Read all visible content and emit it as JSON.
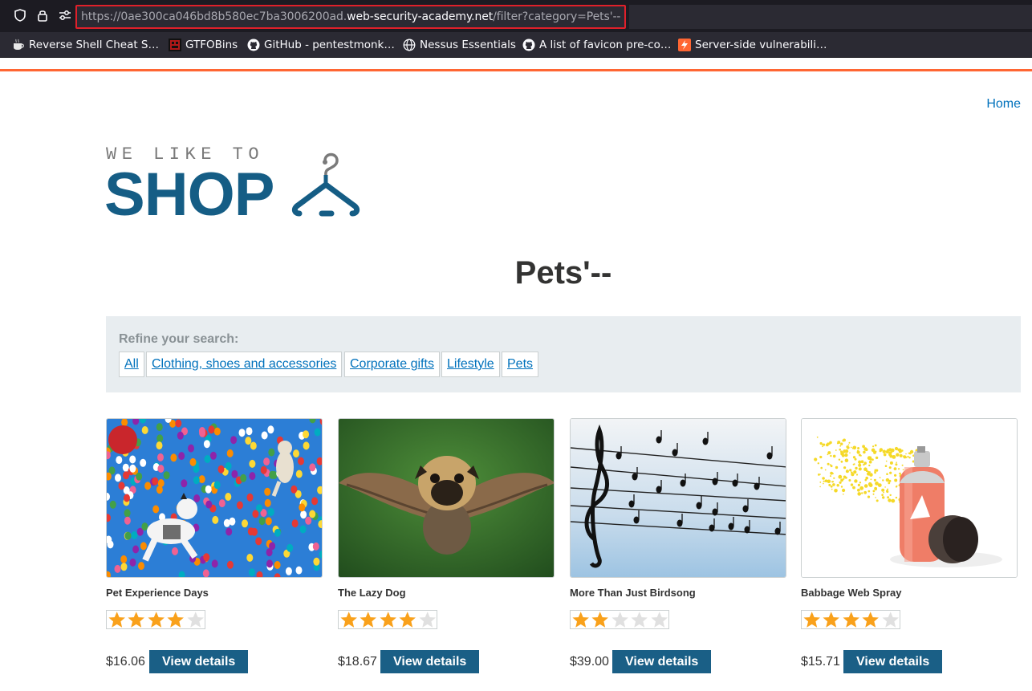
{
  "browser": {
    "url_scheme_prefix": "https://0ae300ca046bd8b580ec7ba3006200ad.",
    "url_host": "web-security-academy.net",
    "url_path": "/filter?category=Pets'--",
    "bookmarks": [
      {
        "label": "Reverse Shell Cheat S…",
        "icon": "coffee-icon"
      },
      {
        "label": "GTFOBins",
        "icon": "gtfobins-icon"
      },
      {
        "label": "GitHub - pentestmonk…",
        "icon": "github-icon"
      },
      {
        "label": "Nessus Essentials",
        "icon": "globe-icon"
      },
      {
        "label": "A list of favicon pre-co…",
        "icon": "github-icon"
      },
      {
        "label": "Server-side vulnerabili…",
        "icon": "portswigger-icon"
      }
    ]
  },
  "nav": {
    "home_label": "Home"
  },
  "logo": {
    "tagline": "WE LIKE TO",
    "word": "SHOP",
    "icon": "hanger-icon"
  },
  "page": {
    "title": "Pets'--"
  },
  "filters": {
    "label": "Refine your search:",
    "options": [
      "All",
      "Clothing, shoes and accessories",
      "Corporate gifts",
      "Lifestyle",
      "Pets"
    ]
  },
  "products": [
    {
      "name": "Pet Experience Days",
      "rating": 4,
      "price": "$16.06",
      "button": "View details",
      "image": "balloons-dogs-image"
    },
    {
      "name": "The Lazy Dog",
      "rating": 4,
      "price": "$18.67",
      "button": "View details",
      "image": "flying-pug-image"
    },
    {
      "name": "More Than Just Birdsong",
      "rating": 2,
      "price": "$39.00",
      "button": "View details",
      "image": "birds-on-wires-image"
    },
    {
      "name": "Babbage Web Spray",
      "rating": 4,
      "price": "$15.71",
      "button": "View details",
      "image": "spray-can-image"
    }
  ],
  "colors": {
    "accent": "#1a5f86",
    "link": "#0071bc",
    "header_line": "#ff6633",
    "star": "#f9a11b"
  }
}
